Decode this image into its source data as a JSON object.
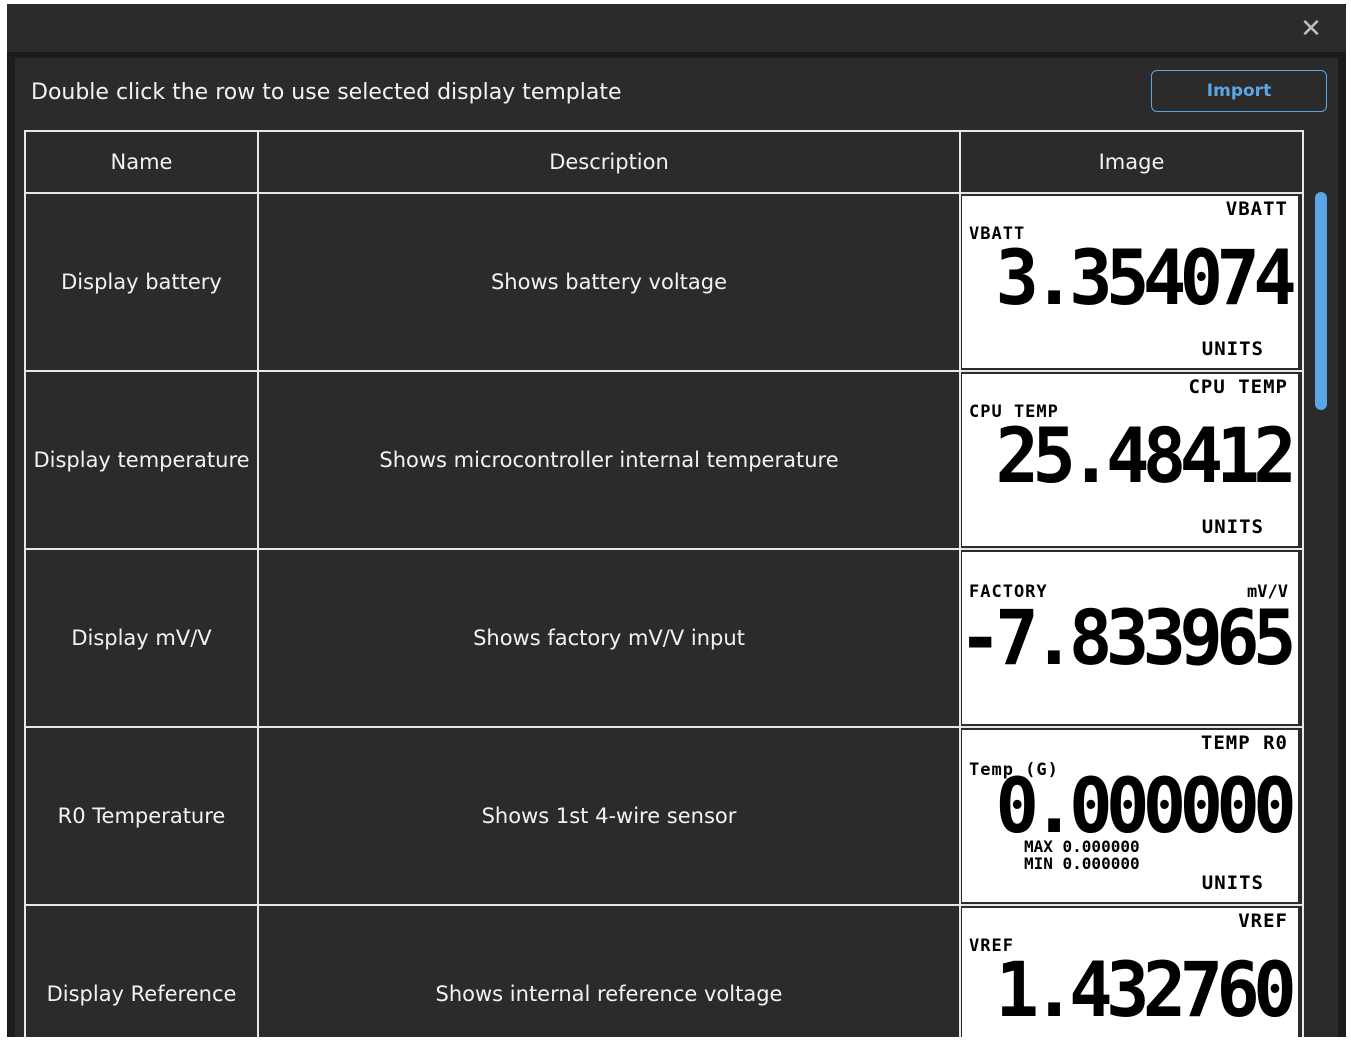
{
  "window": {
    "close_icon": "close-icon"
  },
  "header": {
    "instructions": "Double click the row to use selected display template",
    "import_label": "Import"
  },
  "table": {
    "columns": [
      "Name",
      "Description",
      "Image"
    ],
    "rows": [
      {
        "name": "Display battery",
        "description": "Shows battery voltage",
        "lcd": {
          "top": "VBATT",
          "label": "VBATT",
          "value": "3.354074",
          "units": "UNITS"
        }
      },
      {
        "name": "Display temperature",
        "description": "Shows microcontroller internal temperature",
        "lcd": {
          "top": "CPU TEMP",
          "label": "CPU TEMP",
          "value": "25.48412",
          "units": "UNITS"
        }
      },
      {
        "name": "Display mV/V",
        "description": "Shows factory mV/V input",
        "lcd": {
          "label": "FACTORY",
          "unit_right": "mV/V",
          "value": "-7.833965"
        }
      },
      {
        "name": "R0 Temperature",
        "description": "Shows 1st 4-wire sensor",
        "lcd": {
          "top": "TEMP R0",
          "label": "Temp (G)",
          "value": "0.000000",
          "max": "MAX  0.000000",
          "min": "MIN  0.000000",
          "units": "UNITS"
        }
      },
      {
        "name": "Display Reference",
        "description": "Shows internal reference voltage",
        "lcd": {
          "top": "VREF",
          "label": "VREF",
          "value": "1.432760"
        }
      }
    ]
  },
  "colors": {
    "accent": "#5aa6e6",
    "background": "#2b2b2b",
    "border": "#e8e8e8"
  }
}
